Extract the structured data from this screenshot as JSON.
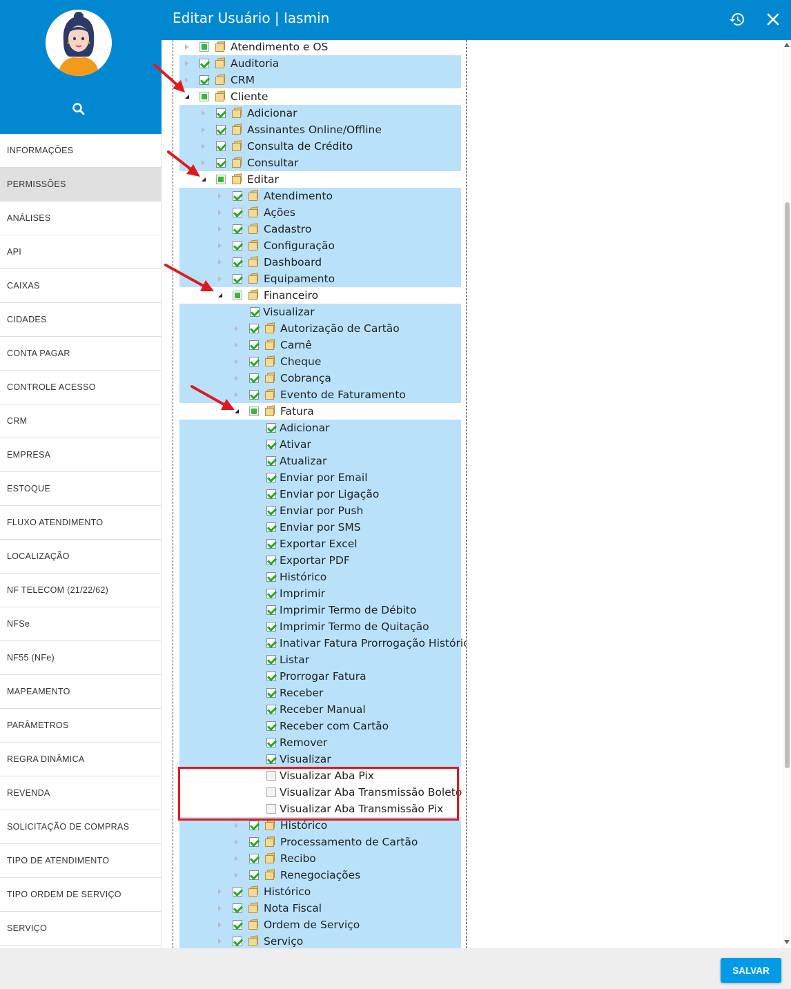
{
  "header": {
    "title": "Editar Usuário | Iasmin",
    "history_icon": "history-icon",
    "close_icon": "close-icon",
    "bg_color": "#0288d1"
  },
  "sidebar": {
    "search_icon": "search-icon",
    "items": [
      {
        "label": "INFORMAÇÕES",
        "active": false
      },
      {
        "label": "PERMISSÕES",
        "active": true
      },
      {
        "label": "ANÁLISES",
        "active": false
      },
      {
        "label": "API",
        "active": false
      },
      {
        "label": "CAIXAS",
        "active": false
      },
      {
        "label": "CIDADES",
        "active": false
      },
      {
        "label": "CONTA PAGAR",
        "active": false
      },
      {
        "label": "CONTROLE ACESSO",
        "active": false
      },
      {
        "label": "CRM",
        "active": false
      },
      {
        "label": "EMPRESA",
        "active": false
      },
      {
        "label": "ESTOQUE",
        "active": false
      },
      {
        "label": "FLUXO ATENDIMENTO",
        "active": false
      },
      {
        "label": "LOCALIZAÇÃO",
        "active": false
      },
      {
        "label": "NF TELECOM (21/22/62)",
        "active": false
      },
      {
        "label": "NFSe",
        "active": false
      },
      {
        "label": "NF55 (NFe)",
        "active": false
      },
      {
        "label": "MAPEAMENTO",
        "active": false
      },
      {
        "label": "PARÂMETROS",
        "active": false
      },
      {
        "label": "REGRA DINÂMICA",
        "active": false
      },
      {
        "label": "REVENDA",
        "active": false
      },
      {
        "label": "SOLICITAÇÃO DE COMPRAS",
        "active": false
      },
      {
        "label": "TIPO DE ATENDIMENTO",
        "active": false
      },
      {
        "label": "TIPO ORDEM DE SERVIÇO",
        "active": false
      },
      {
        "label": "SERVIÇO",
        "active": false
      }
    ]
  },
  "tree": [
    {
      "label": "Atendimento e OS",
      "level": 0,
      "state": "partial",
      "folder": true,
      "arrow": "collapsed",
      "hl": false
    },
    {
      "label": "Auditoria",
      "level": 0,
      "state": "checked",
      "folder": true,
      "arrow": "collapsed",
      "hl": true
    },
    {
      "label": "CRM",
      "level": 0,
      "state": "checked",
      "folder": true,
      "arrow": "collapsed",
      "hl": true
    },
    {
      "label": "Cliente",
      "level": 0,
      "state": "partial",
      "folder": true,
      "arrow": "expanded",
      "hl": false
    },
    {
      "label": "Adicionar",
      "level": 1,
      "state": "checked",
      "folder": true,
      "arrow": "collapsed",
      "hl": true
    },
    {
      "label": "Assinantes Online/Offline",
      "level": 1,
      "state": "checked",
      "folder": true,
      "arrow": "collapsed",
      "hl": true
    },
    {
      "label": "Consulta de Crédito",
      "level": 1,
      "state": "checked",
      "folder": true,
      "arrow": "collapsed",
      "hl": true
    },
    {
      "label": "Consultar",
      "level": 1,
      "state": "checked",
      "folder": true,
      "arrow": "collapsed",
      "hl": true
    },
    {
      "label": "Editar",
      "level": 1,
      "state": "partial",
      "folder": true,
      "arrow": "expanded",
      "hl": false
    },
    {
      "label": "Atendimento",
      "level": 2,
      "state": "checked",
      "folder": true,
      "arrow": "collapsed",
      "hl": true
    },
    {
      "label": "Ações",
      "level": 2,
      "state": "checked",
      "folder": true,
      "arrow": "collapsed",
      "hl": true
    },
    {
      "label": "Cadastro",
      "level": 2,
      "state": "checked",
      "folder": true,
      "arrow": "collapsed",
      "hl": true
    },
    {
      "label": "Configuração",
      "level": 2,
      "state": "checked",
      "folder": true,
      "arrow": "collapsed",
      "hl": true
    },
    {
      "label": "Dashboard",
      "level": 2,
      "state": "checked",
      "folder": true,
      "arrow": "collapsed",
      "hl": true
    },
    {
      "label": "Equipamento",
      "level": 2,
      "state": "checked",
      "folder": true,
      "arrow": "collapsed",
      "hl": true
    },
    {
      "label": "Financeiro",
      "level": 2,
      "state": "partial",
      "folder": true,
      "arrow": "expanded",
      "hl": false
    },
    {
      "label": "Visualizar",
      "level": 3,
      "state": "checked",
      "folder": false,
      "arrow": "none",
      "hl": true
    },
    {
      "label": "Autorização de Cartão",
      "level": 3,
      "state": "checked",
      "folder": true,
      "arrow": "collapsed",
      "hl": true
    },
    {
      "label": "Carnê",
      "level": 3,
      "state": "checked",
      "folder": true,
      "arrow": "collapsed",
      "hl": true
    },
    {
      "label": "Cheque",
      "level": 3,
      "state": "checked",
      "folder": true,
      "arrow": "collapsed",
      "hl": true
    },
    {
      "label": "Cobrança",
      "level": 3,
      "state": "checked",
      "folder": true,
      "arrow": "collapsed",
      "hl": true
    },
    {
      "label": "Evento de Faturamento",
      "level": 3,
      "state": "checked",
      "folder": true,
      "arrow": "collapsed",
      "hl": true
    },
    {
      "label": "Fatura",
      "level": 3,
      "state": "partial",
      "folder": true,
      "arrow": "expanded",
      "hl": false
    },
    {
      "label": "Adicionar",
      "level": 4,
      "state": "checked",
      "folder": false,
      "arrow": "none",
      "hl": true
    },
    {
      "label": "Ativar",
      "level": 4,
      "state": "checked",
      "folder": false,
      "arrow": "none",
      "hl": true
    },
    {
      "label": "Atualizar",
      "level": 4,
      "state": "checked",
      "folder": false,
      "arrow": "none",
      "hl": true
    },
    {
      "label": "Enviar por Email",
      "level": 4,
      "state": "checked",
      "folder": false,
      "arrow": "none",
      "hl": true
    },
    {
      "label": "Enviar por Ligação",
      "level": 4,
      "state": "checked",
      "folder": false,
      "arrow": "none",
      "hl": true
    },
    {
      "label": "Enviar por Push",
      "level": 4,
      "state": "checked",
      "folder": false,
      "arrow": "none",
      "hl": true
    },
    {
      "label": "Enviar por SMS",
      "level": 4,
      "state": "checked",
      "folder": false,
      "arrow": "none",
      "hl": true
    },
    {
      "label": "Exportar Excel",
      "level": 4,
      "state": "checked",
      "folder": false,
      "arrow": "none",
      "hl": true
    },
    {
      "label": "Exportar PDF",
      "level": 4,
      "state": "checked",
      "folder": false,
      "arrow": "none",
      "hl": true
    },
    {
      "label": "Histórico",
      "level": 4,
      "state": "checked",
      "folder": false,
      "arrow": "none",
      "hl": true
    },
    {
      "label": "Imprimir",
      "level": 4,
      "state": "checked",
      "folder": false,
      "arrow": "none",
      "hl": true
    },
    {
      "label": "Imprimir Termo de Débito",
      "level": 4,
      "state": "checked",
      "folder": false,
      "arrow": "none",
      "hl": true
    },
    {
      "label": "Imprimir Termo de Quitação",
      "level": 4,
      "state": "checked",
      "folder": false,
      "arrow": "none",
      "hl": true
    },
    {
      "label": "Inativar Fatura Prorrogação Histórico",
      "level": 4,
      "state": "checked",
      "folder": false,
      "arrow": "none",
      "hl": true
    },
    {
      "label": "Listar",
      "level": 4,
      "state": "checked",
      "folder": false,
      "arrow": "none",
      "hl": true
    },
    {
      "label": "Prorrogar Fatura",
      "level": 4,
      "state": "checked",
      "folder": false,
      "arrow": "none",
      "hl": true
    },
    {
      "label": "Receber",
      "level": 4,
      "state": "checked",
      "folder": false,
      "arrow": "none",
      "hl": true
    },
    {
      "label": "Receber Manual",
      "level": 4,
      "state": "checked",
      "folder": false,
      "arrow": "none",
      "hl": true
    },
    {
      "label": "Receber com Cartão",
      "level": 4,
      "state": "checked",
      "folder": false,
      "arrow": "none",
      "hl": true
    },
    {
      "label": "Remover",
      "level": 4,
      "state": "checked",
      "folder": false,
      "arrow": "none",
      "hl": true
    },
    {
      "label": "Visualizar",
      "level": 4,
      "state": "checked",
      "folder": false,
      "arrow": "none",
      "hl": true
    },
    {
      "label": "Visualizar Aba Pix",
      "level": 4,
      "state": "unchecked",
      "folder": false,
      "arrow": "none",
      "hl": false
    },
    {
      "label": "Visualizar Aba Transmissão Boleto",
      "level": 4,
      "state": "unchecked",
      "folder": false,
      "arrow": "none",
      "hl": false
    },
    {
      "label": "Visualizar Aba Transmissão Pix",
      "level": 4,
      "state": "unchecked",
      "folder": false,
      "arrow": "none",
      "hl": false
    },
    {
      "label": "Histórico",
      "level": 3,
      "state": "checked",
      "folder": true,
      "arrow": "collapsed",
      "hl": true
    },
    {
      "label": "Processamento de Cartão",
      "level": 3,
      "state": "checked",
      "folder": true,
      "arrow": "collapsed",
      "hl": true
    },
    {
      "label": "Recibo",
      "level": 3,
      "state": "checked",
      "folder": true,
      "arrow": "collapsed",
      "hl": true
    },
    {
      "label": "Renegociações",
      "level": 3,
      "state": "checked",
      "folder": true,
      "arrow": "collapsed",
      "hl": true
    },
    {
      "label": "Histórico",
      "level": 2,
      "state": "checked",
      "folder": true,
      "arrow": "collapsed",
      "hl": true
    },
    {
      "label": "Nota Fiscal",
      "level": 2,
      "state": "checked",
      "folder": true,
      "arrow": "collapsed",
      "hl": true
    },
    {
      "label": "Ordem de Serviço",
      "level": 2,
      "state": "checked",
      "folder": true,
      "arrow": "collapsed",
      "hl": true
    },
    {
      "label": "Serviço",
      "level": 2,
      "state": "checked",
      "folder": true,
      "arrow": "collapsed",
      "hl": true
    }
  ],
  "annotation_color": "#e0191f",
  "tree_highlight_color": "#b9e2fa",
  "footer": {
    "save_label": "SALVAR",
    "save_color": "#039be5"
  }
}
